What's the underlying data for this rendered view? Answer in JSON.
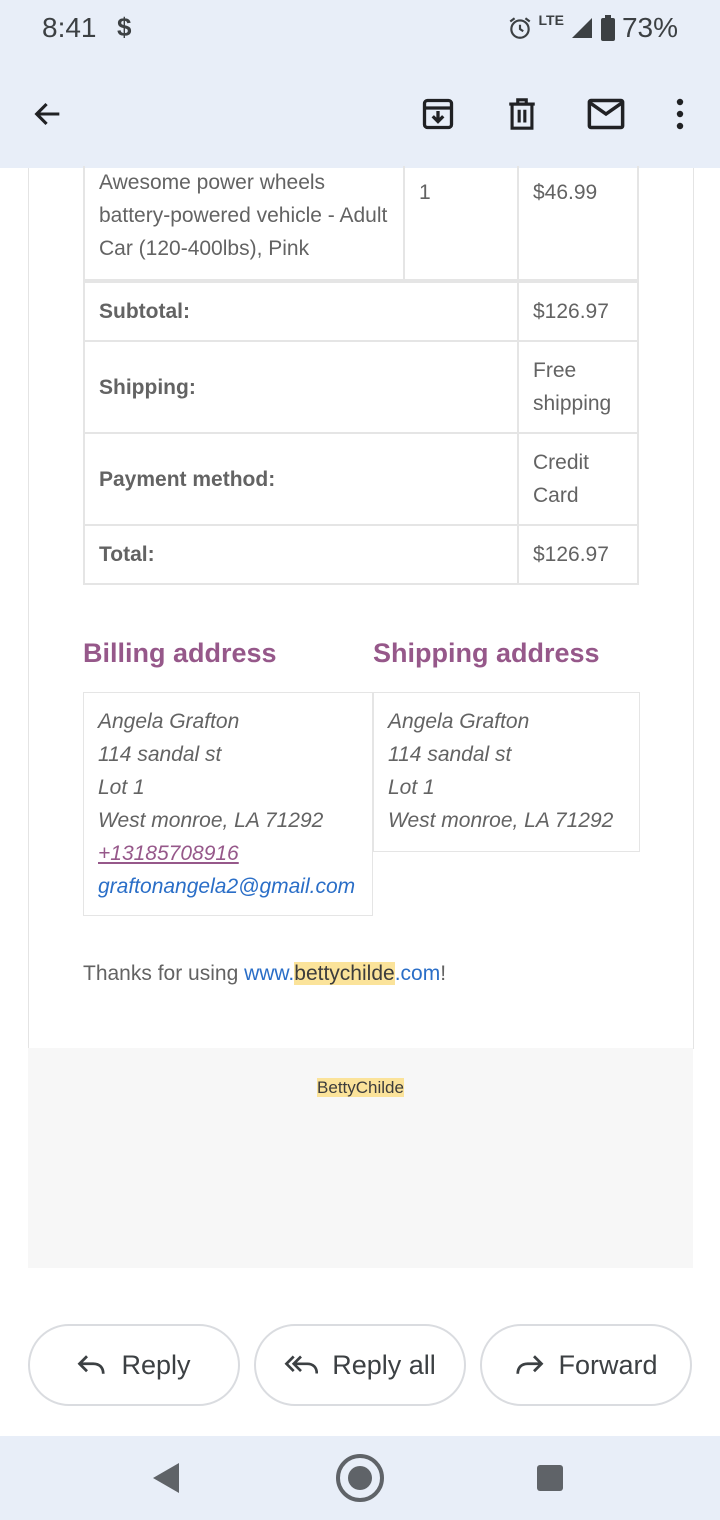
{
  "status_bar": {
    "time": "8:41",
    "notification_glyph": "$",
    "network": "LTE",
    "battery": "73%",
    "icons": [
      "alarm-icon",
      "signal-icon",
      "battery-icon"
    ]
  },
  "app_bar": {
    "icons": [
      "back-arrow-icon",
      "archive-icon",
      "delete-icon",
      "mark-unread-icon",
      "more-vert-icon"
    ]
  },
  "order": {
    "item": {
      "name": "Awesome power wheels battery-powered vehicle - Adult Car (120-400lbs), Pink",
      "quantity": "1",
      "price": "$46.99"
    },
    "totals": [
      {
        "label": "Subtotal:",
        "value": "$126.97"
      },
      {
        "label": "Shipping:",
        "value": "Free shipping"
      },
      {
        "label": "Payment method:",
        "value": "Credit Card"
      },
      {
        "label": "Total:",
        "value": "$126.97"
      }
    ]
  },
  "billing": {
    "heading": "Billing address",
    "name": "Angela Grafton",
    "street": "114 sandal st",
    "lot": "Lot 1",
    "city": "West monroe, LA 71292",
    "phone": "+13185708916",
    "email": "graftonangela2@gmail.com"
  },
  "shipping": {
    "heading": "Shipping address",
    "name": "Angela Grafton",
    "street": "114 sandal st",
    "lot": "Lot 1",
    "city": "West monroe, LA 71292"
  },
  "thanks": {
    "prefix": "Thanks for using ",
    "link_pre": "www.",
    "link_highlight": "bettychilde",
    "link_post": ".com",
    "suffix": "!"
  },
  "footer": {
    "brand": "BettyChilde"
  },
  "actions": {
    "reply": "Reply",
    "reply_all": "Reply all",
    "forward": "Forward"
  },
  "colors": {
    "accent_purple": "#96588a",
    "link_blue": "#2a6ec7",
    "highlight": "#fbe39a",
    "chrome_bg": "#e8eef8"
  }
}
